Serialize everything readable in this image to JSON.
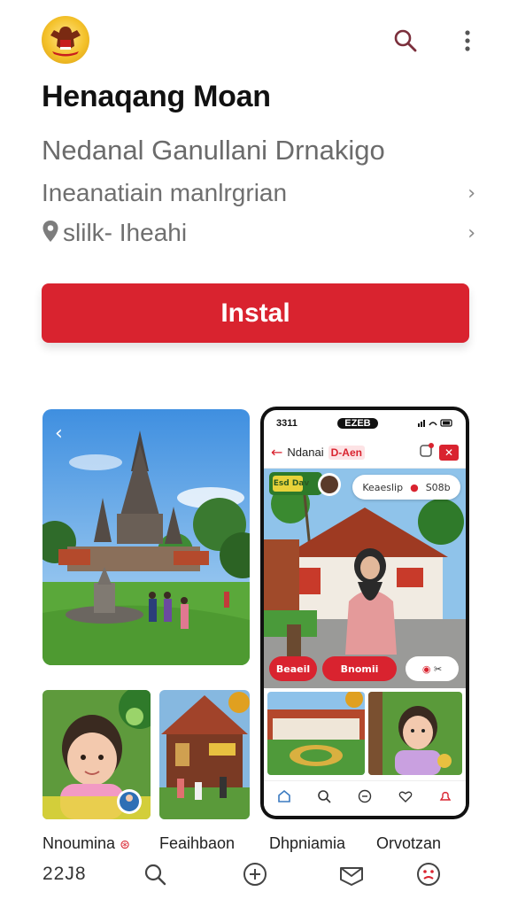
{
  "header": {
    "logo_icon": "garuda-emblem-icon",
    "search_icon": "search-icon",
    "menu_icon": "more-vertical-icon"
  },
  "app": {
    "title": "Henaqang Moan",
    "subtitle": "Nedanal Ganullani Drnakigo",
    "info_line": "Ineanatiain manlrgrian",
    "location": "slilk- Iheahi"
  },
  "install": {
    "label": "Instal"
  },
  "phone": {
    "time": "3311",
    "notch_text": "EZEB",
    "title": "Ndanai",
    "tag": "D-Aen",
    "chip_left": "Esd Dav",
    "chip_right_a": "Keaeslip",
    "chip_right_b": "S08b",
    "btn_one": "Beaeil",
    "btn_two": "Bnomii"
  },
  "captions": {
    "c1": "Nnoumina",
    "c2": "Feaihbaon",
    "c3": "Dhpniamia",
    "c4": "Orvotzan"
  },
  "bottom": {
    "count": "22J8",
    "icons": [
      "search-icon",
      "plus-circle-icon",
      "mail-icon",
      "smiley-icon"
    ]
  },
  "colors": {
    "accent": "#d9232f",
    "text_muted": "#6b6b6b"
  }
}
